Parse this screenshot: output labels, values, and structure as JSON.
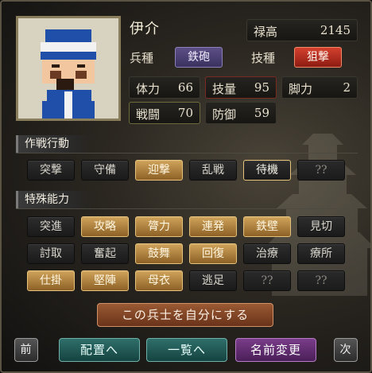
{
  "officer": {
    "name": "伊介",
    "stipend_label": "禄高",
    "stipend_value": "2145",
    "unit_type_label": "兵種",
    "unit_type_value": "鉄砲",
    "skill_type_label": "技種",
    "skill_type_value": "狙撃"
  },
  "stats": {
    "tairyoku_label": "体力",
    "tairyoku_value": "66",
    "giryou_label": "技量",
    "giryou_value": "95",
    "kyakuryoku_label": "脚力",
    "kyakuryoku_value": "2",
    "sentou_label": "戦闘",
    "sentou_value": "70",
    "bougyo_label": "防御",
    "bougyo_value": "59"
  },
  "tactics": {
    "title": "作戦行動",
    "items": [
      "突撃",
      "守備",
      "迎撃",
      "乱戦",
      "待機",
      "??"
    ]
  },
  "abilities": {
    "title": "特殊能力",
    "row1": [
      "突進",
      "攻略",
      "膂力",
      "連発",
      "鉄壁",
      "見切"
    ],
    "row2": [
      "討取",
      "奮起",
      "鼓舞",
      "回復",
      "治療",
      "療所"
    ],
    "row3": [
      "仕掛",
      "堅陣",
      "母衣",
      "逃足",
      "??",
      "??"
    ]
  },
  "actions": {
    "make_self": "この兵士を自分にする",
    "prev": "前",
    "assign": "配置へ",
    "list": "一覧へ",
    "rename": "名前変更",
    "next": "次"
  },
  "colors": {
    "gold": "#cfa35a",
    "purple_tag": "#5c4f86",
    "red_tag": "#d4402e"
  }
}
